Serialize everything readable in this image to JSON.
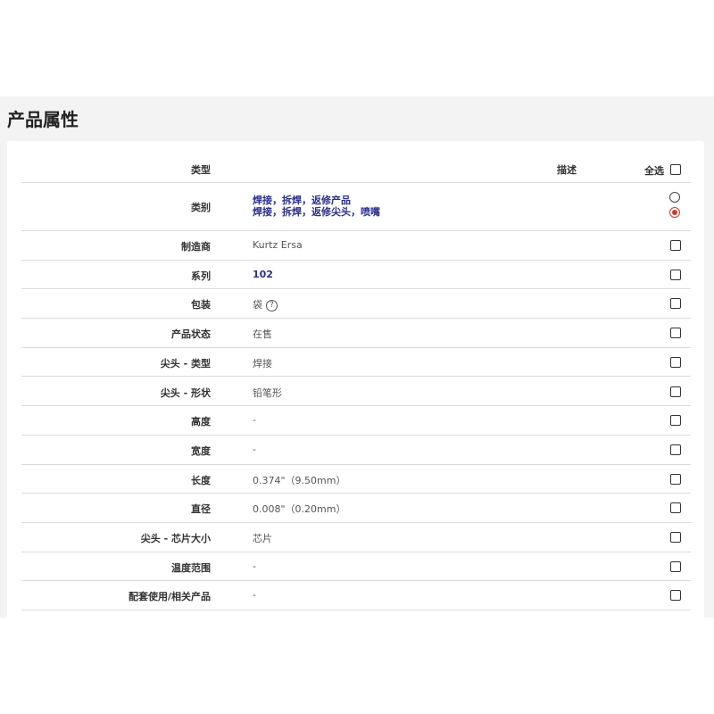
{
  "page": {
    "title": "产品属性"
  },
  "table": {
    "header": {
      "type_label": "类型",
      "description_label": "描述",
      "select_all_label": "全选"
    },
    "category": {
      "label": "类别",
      "options": [
        {
          "text": "焊接，拆焊，返修产品",
          "selected": false
        },
        {
          "text": "焊接，拆焊，返修尖头，喷嘴",
          "selected": true
        }
      ]
    },
    "rows": [
      {
        "label": "制造商",
        "value": "Kurtz Ersa",
        "is_link": false
      },
      {
        "label": "系列",
        "value": "102",
        "is_link": true
      },
      {
        "label": "包装",
        "value": "袋",
        "is_link": false,
        "help_icon": "?"
      },
      {
        "label": "产品状态",
        "value": "在售",
        "is_link": false
      },
      {
        "label": "尖头 - 类型",
        "value": "焊接",
        "is_link": false
      },
      {
        "label": "尖头 - 形状",
        "value": "铅笔形",
        "is_link": false
      },
      {
        "label": "高度",
        "value": "-",
        "is_link": false
      },
      {
        "label": "宽度",
        "value": "-",
        "is_link": false
      },
      {
        "label": "长度",
        "value": "0.374\"（9.50mm）",
        "is_link": false
      },
      {
        "label": "直径",
        "value": "0.008\"（0.20mm）",
        "is_link": false
      },
      {
        "label": "尖头 - 芯片大小",
        "value": "芯片",
        "is_link": false
      },
      {
        "label": "温度范围",
        "value": "-",
        "is_link": false
      },
      {
        "label": "配套使用/相关产品",
        "value": "-",
        "is_link": false
      }
    ]
  },
  "colors": {
    "link": "#2b2f8f",
    "radio_selected": "#d23b2f",
    "panel_bg": "#f3f3f3"
  }
}
